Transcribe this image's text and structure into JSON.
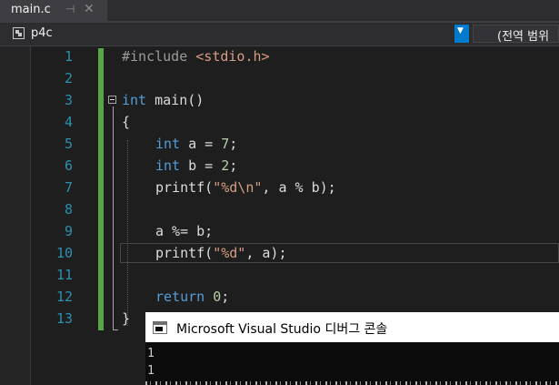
{
  "tab": {
    "title": "main.c",
    "pin_icon": "pin-icon",
    "close_icon": "close-icon",
    "pin_glyph": "⊣",
    "close_glyph": "✕"
  },
  "navbar": {
    "project": "p4c",
    "scope": "(전역 범위",
    "dropdown_glyph": "▼"
  },
  "editor": {
    "line_numbers": [
      "1",
      "2",
      "3",
      "4",
      "5",
      "6",
      "7",
      "8",
      "9",
      "10",
      "11",
      "12",
      "13"
    ]
  },
  "code": {
    "l1_directive": "#include",
    "l1_header": "<stdio.h>",
    "l3_type": "int",
    "l3_rest": " main()",
    "l4": "{",
    "l5_type": "int",
    "l5_rest1": " a = ",
    "l5_num": "7",
    "l5_rest2": ";",
    "l6_type": "int",
    "l6_rest1": " b = ",
    "l6_num": "2",
    "l6_rest2": ";",
    "l7_a": "printf(",
    "l7_str": "\"%d\\n\"",
    "l7_b": ", a % b);",
    "l9": "a %= b;",
    "l10_a": "printf(",
    "l10_str": "\"%d\"",
    "l10_b": ", a);",
    "l12_kw": "return",
    "l12_sp": " ",
    "l12_num": "0",
    "l12_end": ";",
    "l13": "}"
  },
  "console": {
    "title": "Microsoft Visual Studio 디버그 콘솔",
    "output": [
      "1",
      "1"
    ]
  },
  "colors": {
    "editor_bg": "#1e1e1e",
    "keyword": "#569cd6",
    "string": "#d69d85",
    "number": "#b5cea8",
    "line_number": "#2b91af",
    "change_bar": "#57a64a",
    "accent": "#007acc"
  }
}
